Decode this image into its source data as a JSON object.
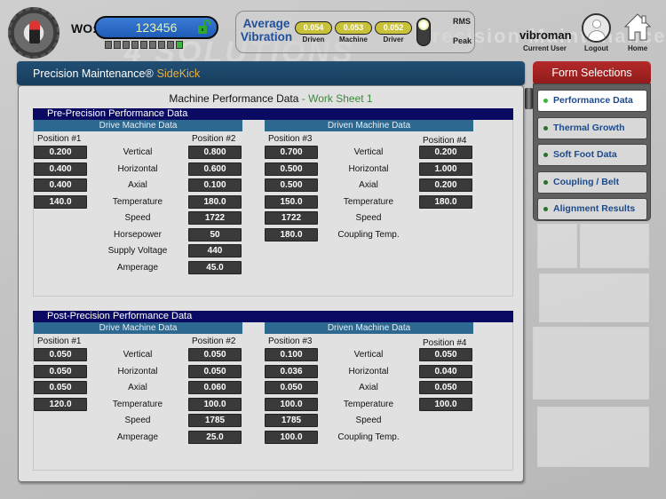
{
  "header": {
    "wo_label": "WO:",
    "wo_value": "123456",
    "wo_progress": {
      "filled": 1,
      "total": 9
    },
    "vibration": {
      "title_line1": "Average",
      "title_line2": "Vibration",
      "readings": [
        {
          "label": "Driven",
          "value": "0.054"
        },
        {
          "label": "Machine",
          "value": "0.053"
        },
        {
          "label": "Driver",
          "value": "0.052"
        }
      ],
      "mode_options": [
        "RMS",
        "Peak"
      ],
      "mode_selected": "RMS"
    },
    "user": {
      "name": "vibroman",
      "caption": "Current User"
    },
    "logout_label": "Logout",
    "home_label": "Home",
    "watermark": "Precision Maintenance"
  },
  "app_bar": {
    "title": "Precision  Maintenance®",
    "product": "SideKick"
  },
  "panel": {
    "title": "Machine Performance Data",
    "worksheet": "- Work Sheet 1"
  },
  "pre": {
    "title": "Pre-Precision Performance Data",
    "drive": {
      "title": "Drive Machine Data",
      "pos_a": "Position #1",
      "pos_b": "Position #2",
      "rows": [
        {
          "label": "Vertical",
          "a": "0.200",
          "b": "0.800"
        },
        {
          "label": "Horizontal",
          "a": "0.400",
          "b": "0.600"
        },
        {
          "label": "Axial",
          "a": "0.400",
          "b": "0.100"
        },
        {
          "label": "Temperature",
          "a": "140.0",
          "b": "180.0"
        },
        {
          "label": "Speed",
          "b": "1722"
        },
        {
          "label": "Horsepower",
          "b": "50"
        },
        {
          "label": "Supply Voltage",
          "b": "440"
        },
        {
          "label": "Amperage",
          "b": "45.0"
        }
      ]
    },
    "driven": {
      "title": "Driven Machine Data",
      "pos_a": "Position #3",
      "pos_b": "Position #4",
      "rows": [
        {
          "label": "Vertical",
          "a": "0.700",
          "b": "0.200"
        },
        {
          "label": "Horizontal",
          "a": "0.500",
          "b": "1.000"
        },
        {
          "label": "Axial",
          "a": "0.500",
          "b": "0.200"
        },
        {
          "label": "Temperature",
          "a": "150.0",
          "b": "180.0"
        },
        {
          "label": "Speed",
          "a": "1722"
        },
        {
          "label": "Coupling Temp.",
          "a": "180.0"
        }
      ]
    }
  },
  "post": {
    "title": "Post-Precision Performance Data",
    "drive": {
      "title": "Drive Machine Data",
      "pos_a": "Position #1",
      "pos_b": "Position #2",
      "rows": [
        {
          "label": "Vertical",
          "a": "0.050",
          "b": "0.050"
        },
        {
          "label": "Horizontal",
          "a": "0.050",
          "b": "0.050"
        },
        {
          "label": "Axial",
          "a": "0.050",
          "b": "0.060"
        },
        {
          "label": "Temperature",
          "a": "120.0",
          "b": "100.0"
        },
        {
          "label": "Speed",
          "b": "1785"
        },
        {
          "label": "Amperage",
          "b": "25.0"
        }
      ]
    },
    "driven": {
      "title": "Driven Machine Data",
      "pos_a": "Position #3",
      "pos_b": "Position #4",
      "rows": [
        {
          "label": "Vertical",
          "a": "0.100",
          "b": "0.050"
        },
        {
          "label": "Horizontal",
          "a": "0.036",
          "b": "0.040"
        },
        {
          "label": "Axial",
          "a": "0.050",
          "b": "0.050"
        },
        {
          "label": "Temperature",
          "a": "100.0",
          "b": "100.0"
        },
        {
          "label": "Speed",
          "a": "1785"
        },
        {
          "label": "Coupling Temp.",
          "a": "100.0"
        }
      ]
    }
  },
  "form_selections": {
    "title": "Form Selections",
    "items": [
      {
        "label": "Performance Data",
        "active": true
      },
      {
        "label": "Thermal Growth",
        "active": false
      },
      {
        "label": "Soft Foot Data",
        "active": false
      },
      {
        "label": "Coupling / Belt",
        "active": false
      },
      {
        "label": "Alignment Results",
        "active": false
      }
    ]
  },
  "colors": {
    "section_bar": "#0a0a63",
    "sub_bar": "#2d6890",
    "app_bar": "#1c4566",
    "form_head": "#a42222",
    "product_accent": "#e8b040",
    "worksheet_accent": "#3a8a3a",
    "value_box": "#3a3a3a",
    "vib_pill": "#c8c23a"
  }
}
